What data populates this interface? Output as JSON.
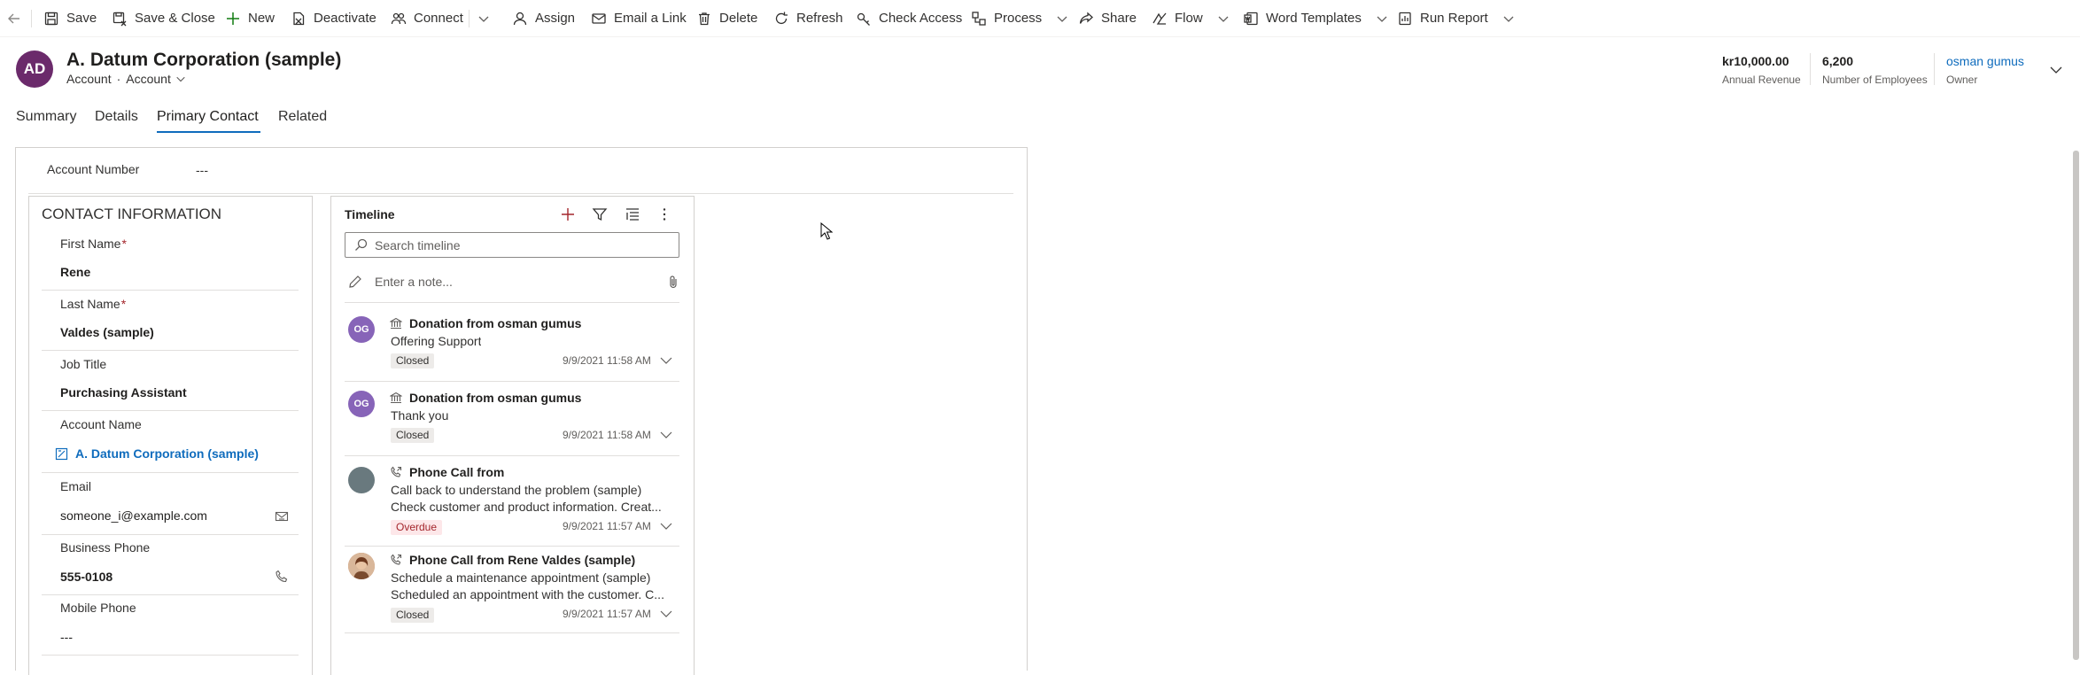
{
  "command_bar": {
    "save": "Save",
    "save_close": "Save & Close",
    "new": "New",
    "deactivate": "Deactivate",
    "connect": "Connect",
    "assign": "Assign",
    "email_link": "Email a Link",
    "delete": "Delete",
    "refresh": "Refresh",
    "check_access": "Check Access",
    "process": "Process",
    "share": "Share",
    "flow": "Flow",
    "word_templates": "Word Templates",
    "run_report": "Run Report"
  },
  "record": {
    "initials": "AD",
    "title": "A. Datum Corporation (sample)",
    "entity": "Account",
    "form": "Account",
    "avatar_color": "#6b2a6b"
  },
  "header_fields": {
    "annual_revenue": {
      "value": "kr10,000.00",
      "label": "Annual Revenue"
    },
    "employees": {
      "value": "6,200",
      "label": "Number of Employees"
    },
    "owner": {
      "value": "osman gumus",
      "label": "Owner"
    }
  },
  "tabs": [
    "Summary",
    "Details",
    "Primary Contact",
    "Related"
  ],
  "active_tab": "Primary Contact",
  "account_number": {
    "label": "Account Number",
    "value": "---"
  },
  "contact_info": {
    "title": "CONTACT INFORMATION",
    "first_name": {
      "label": "First Name",
      "required": "*",
      "value": "Rene"
    },
    "last_name": {
      "label": "Last Name",
      "required": "*",
      "value": "Valdes (sample)"
    },
    "job_title": {
      "label": "Job Title",
      "value": "Purchasing Assistant"
    },
    "account_name": {
      "label": "Account Name",
      "value": "A. Datum Corporation (sample)"
    },
    "email": {
      "label": "Email",
      "value": "someone_i@example.com"
    },
    "business_phone": {
      "label": "Business Phone",
      "value": "555-0108"
    },
    "mobile_phone": {
      "label": "Mobile Phone",
      "value": "---"
    }
  },
  "timeline": {
    "title": "Timeline",
    "search_placeholder": "Search timeline",
    "note_placeholder": "Enter a note...",
    "items": [
      {
        "initials": "OG",
        "title": "Donation from osman gumus",
        "line1": "Offering Support",
        "line2": "",
        "status": "Closed",
        "date": "9/9/2021 11:58 AM",
        "icon": "bank-icon",
        "avatar_color": "#8764b8"
      },
      {
        "initials": "OG",
        "title": "Donation from osman gumus",
        "line1": "Thank you",
        "line2": "",
        "status": "Closed",
        "date": "9/9/2021 11:58 AM",
        "icon": "bank-icon",
        "avatar_color": "#8764b8"
      },
      {
        "initials": "",
        "title": "Phone Call from",
        "line1": "Call back to understand the problem (sample)",
        "line2": "Check customer and product information. Creat...",
        "status": "Overdue",
        "date": "9/9/2021 11:57 AM",
        "icon": "phone-icon",
        "avatar_color": "#69797e"
      },
      {
        "initials": "",
        "title": "Phone Call from Rene Valdes (sample)",
        "line1": "Schedule a maintenance appointment (sample)",
        "line2": "Scheduled an appointment with the customer. C...",
        "status": "Closed",
        "date": "9/9/2021 11:57 AM",
        "icon": "phone-icon",
        "avatar_color": "#c07d52"
      }
    ]
  }
}
